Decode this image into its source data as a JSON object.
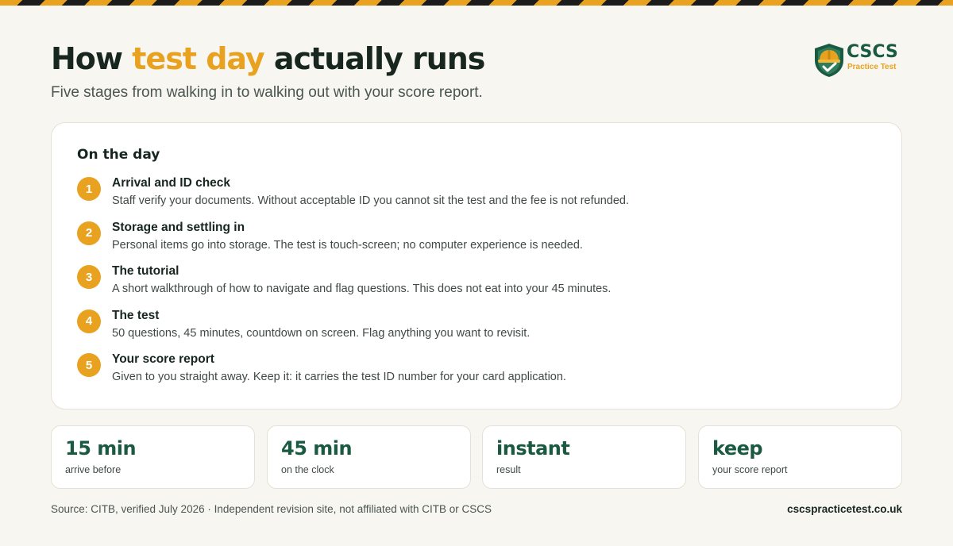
{
  "header": {
    "title_pre": "How ",
    "title_accent": "test day",
    "title_post": " actually runs",
    "subtitle": "Five stages from walking in to walking out with your score report."
  },
  "logo": {
    "name": "CSCS",
    "tagline": "Practice Test",
    "icon": "hard-hat-shield-icon"
  },
  "card": {
    "heading": "On the day",
    "steps": [
      {
        "number": "1",
        "title": "Arrival and ID check",
        "description": "Staff verify your documents. Without acceptable ID you cannot sit the test and the fee is not refunded."
      },
      {
        "number": "2",
        "title": "Storage and settling in",
        "description": "Personal items go into storage. The test is touch-screen; no computer experience is needed."
      },
      {
        "number": "3",
        "title": "The tutorial",
        "description": "A short walkthrough of how to navigate and flag questions. This does not eat into your 45 minutes."
      },
      {
        "number": "4",
        "title": "The test",
        "description": "50 questions, 45 minutes, countdown on screen. Flag anything you want to revisit."
      },
      {
        "number": "5",
        "title": "Your score report",
        "description": "Given to you straight away. Keep it: it carries the test ID number for your card application."
      }
    ]
  },
  "stats": [
    {
      "value": "15 min",
      "label": "arrive before"
    },
    {
      "value": "45 min",
      "label": "on the clock"
    },
    {
      "value": "instant",
      "label": "result"
    },
    {
      "value": "keep",
      "label": "your score report"
    }
  ],
  "footer": {
    "source": "Source: CITB, verified July 2026 · Independent revision site, not affiliated with CITB or CSCS",
    "site": "cscspracticetest.co.uk"
  },
  "colors": {
    "accent": "#e8a21f",
    "brand_green": "#1b5a42",
    "background": "#f8f6f1"
  }
}
